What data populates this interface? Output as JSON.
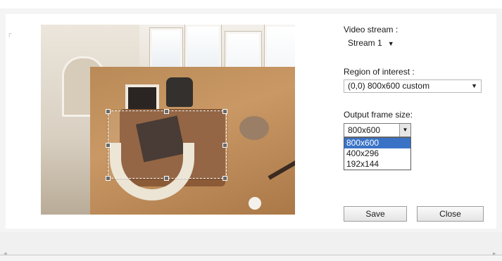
{
  "video_stream": {
    "label": "Video stream :",
    "selected": "Stream 1"
  },
  "region_of_interest": {
    "label": "Region of interest :",
    "selected": "(0,0) 800x600 custom"
  },
  "output_frame_size": {
    "label": "Output frame size:",
    "selected": "800x600",
    "options": [
      "800x600",
      "400x296",
      "192x144"
    ],
    "highlighted_index": 0
  },
  "buttons": {
    "save_label": "Save",
    "close_label": "Close"
  },
  "colors": {
    "highlight": "#3a73c6",
    "border": "#b7b7b7",
    "background": "#f4f4f4"
  }
}
